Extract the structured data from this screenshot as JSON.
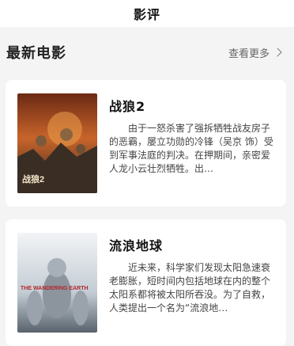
{
  "header": {
    "title": "影评"
  },
  "section": {
    "title": "最新电影",
    "more_label": "查看更多"
  },
  "movies": [
    {
      "title": "战狼2",
      "description": "由于一怒杀害了强拆牺牲战友房子的恶霸，屡立功勋的冷锋（吴京 饰）受到军事法庭的判决。在押期间，亲密爱人龙小云壮烈牺牲。出…",
      "poster_text": "战狼2",
      "poster_colors": [
        "#8a3a1e",
        "#c8642a",
        "#3b3025"
      ]
    },
    {
      "title": "流浪地球",
      "description": "近未来，科学家们发现太阳急速衰老膨胀，短时间内包括地球在内的整个太阳系都将被太阳所吞没。为了自救，人类提出一个名为“流浪地…",
      "poster_text": "THE WANDERING EARTH",
      "poster_colors": [
        "#e8ecef",
        "#b9c3cc",
        "#5d6b78"
      ]
    }
  ]
}
